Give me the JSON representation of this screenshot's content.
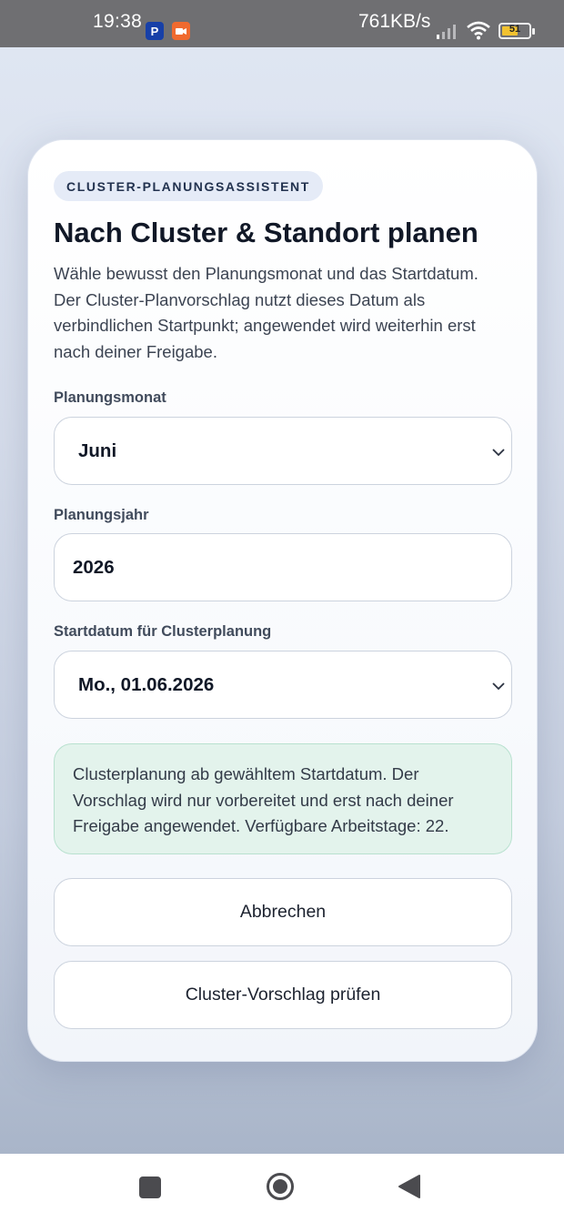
{
  "status_bar": {
    "time": "19:38",
    "speed": "761KB/s",
    "battery": "51",
    "app_icons": [
      "paypal-icon",
      "video-recorder-icon"
    ]
  },
  "dialog": {
    "eyebrow": "CLUSTER-PLANUNGSASSISTENT",
    "title": "Nach Cluster & Standort planen",
    "description": "Wähle bewusst den Planungsmonat und das Startdatum. Der Cluster-Planvorschlag nutzt dieses Datum als verbindlichen Startpunkt; angewendet wird weiterhin erst nach deiner Freigabe.",
    "month": {
      "label": "Planungsmonat",
      "value": "Juni"
    },
    "year": {
      "label": "Planungsjahr",
      "value": "2026"
    },
    "start_date": {
      "label": "Startdatum für Clusterplanung",
      "value": "Mo., 01.06.2026"
    },
    "info": "Clusterplanung ab gewähltem Startdatum. Der Vorschlag wird nur vorbereitet und erst nach deiner Freigabe angewendet. Verfügbare Arbeitstage: 22.",
    "cancel_label": "Abbrechen",
    "review_label": "Cluster-Vorschlag prüfen"
  },
  "colors": {
    "info_background": "#e3f3ec",
    "eyebrow_background": "#e5ebf7",
    "status_bar": "#6f6f72"
  }
}
